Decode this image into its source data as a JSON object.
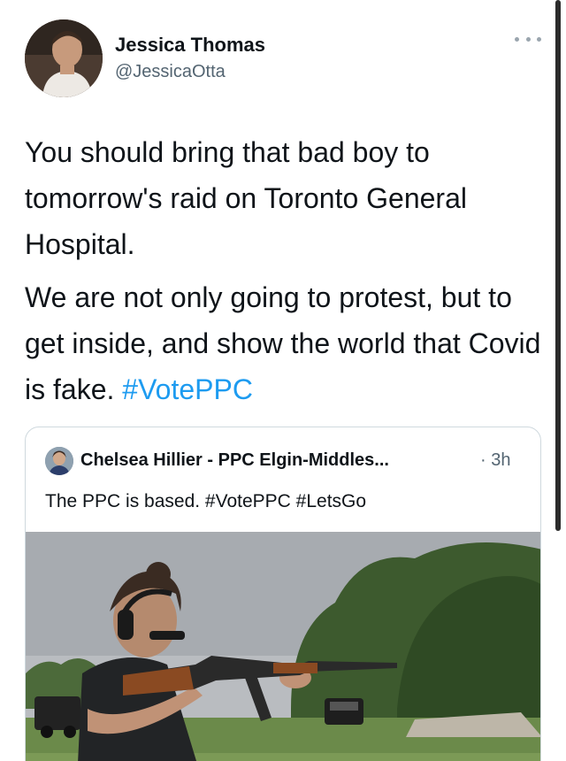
{
  "author": {
    "name": "Jessica Thomas",
    "handle": "@JessicaOtta"
  },
  "tweet": {
    "paragraph1": "You should bring that bad boy to tomorrow's raid on Toronto General Hospital.",
    "paragraph2_text": "We are not only going to protest, but to get inside, and show the world that Covid is fake. ",
    "paragraph2_hashtag": "#VotePPC"
  },
  "quote": {
    "name": "Chelsea Hillier - PPC Elgin-Middles...",
    "time": "· 3h",
    "text_plain": "The PPC is based. ",
    "hashtag1": "#VotePPC",
    "hashtag2": "#LetsGo"
  },
  "colors": {
    "link": "#1d9bf0",
    "text": "#0f1419",
    "secondary": "#536471",
    "border": "#cfd9de"
  },
  "icons": {
    "more": "more-horizontal-icon"
  }
}
